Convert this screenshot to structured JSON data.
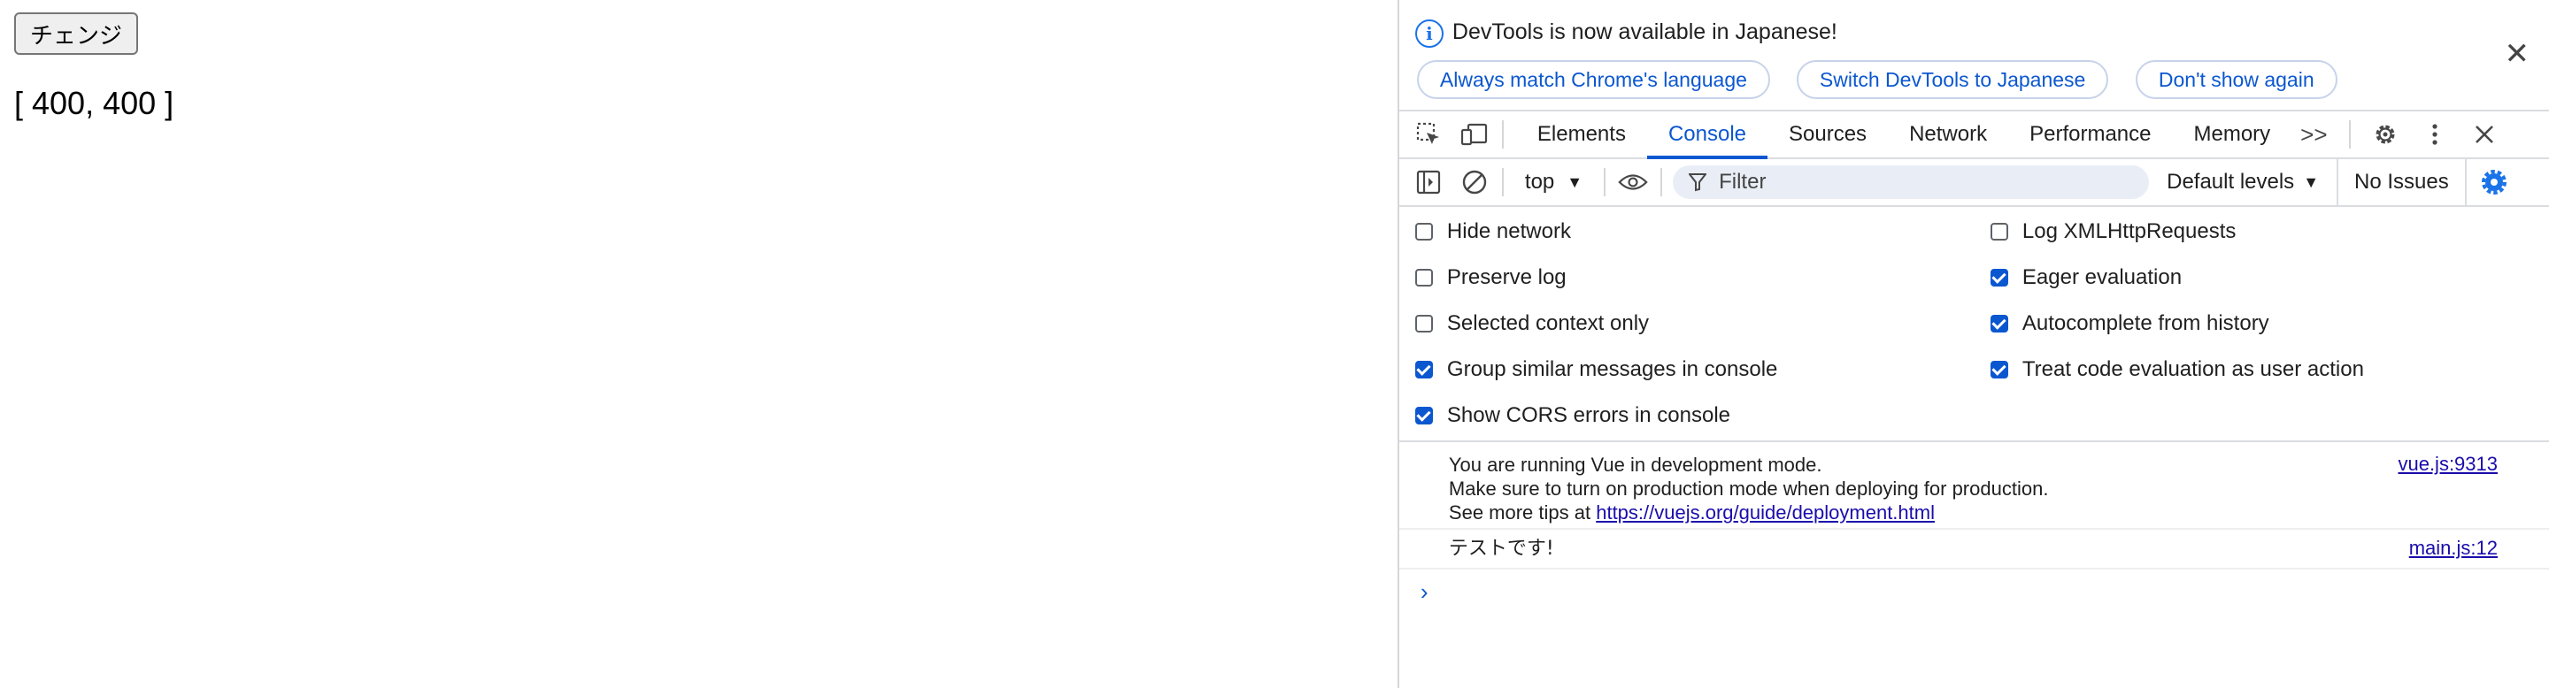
{
  "page": {
    "button_label": "チェンジ",
    "array_text": "[ 400, 400 ]"
  },
  "devtools": {
    "infobar": {
      "message": "DevTools is now available in Japanese!",
      "buttons": [
        "Always match Chrome's language",
        "Switch DevTools to Japanese",
        "Don't show again"
      ],
      "close_icon": "close-icon"
    },
    "tabs": [
      "Elements",
      "Console",
      "Sources",
      "Network",
      "Performance",
      "Memory"
    ],
    "active_tab": "Console",
    "more_tabs_glyph": ">>",
    "toolbar_icons": [
      "inspect-element-icon",
      "device-toolbar-icon",
      "settings-gear-icon",
      "kebab-menu-icon",
      "close-icon"
    ],
    "console_toolbar": {
      "context": "top",
      "filter_placeholder": "Filter",
      "levels": "Default levels",
      "issues": "No Issues"
    },
    "settings": {
      "left": [
        {
          "label": "Hide network",
          "checked": false
        },
        {
          "label": "Preserve log",
          "checked": false
        },
        {
          "label": "Selected context only",
          "checked": false
        },
        {
          "label": "Group similar messages in console",
          "checked": true
        },
        {
          "label": "Show CORS errors in console",
          "checked": true
        }
      ],
      "right": [
        {
          "label": "Log XMLHttpRequests",
          "checked": false
        },
        {
          "label": "Eager evaluation",
          "checked": true
        },
        {
          "label": "Autocomplete from history",
          "checked": true
        },
        {
          "label": "Treat code evaluation as user action",
          "checked": true
        }
      ]
    },
    "messages": [
      {
        "lines": [
          "You are running Vue in development mode.",
          "Make sure to turn on production mode when deploying for production.",
          "See more tips at "
        ],
        "link": "https://vuejs.org/guide/deployment.html",
        "source": "vue.js:9313"
      },
      {
        "lines": [
          "テストです!"
        ],
        "source": "main.js:12"
      }
    ],
    "prompt_glyph": "›",
    "accent_color": "#0b57d0"
  }
}
